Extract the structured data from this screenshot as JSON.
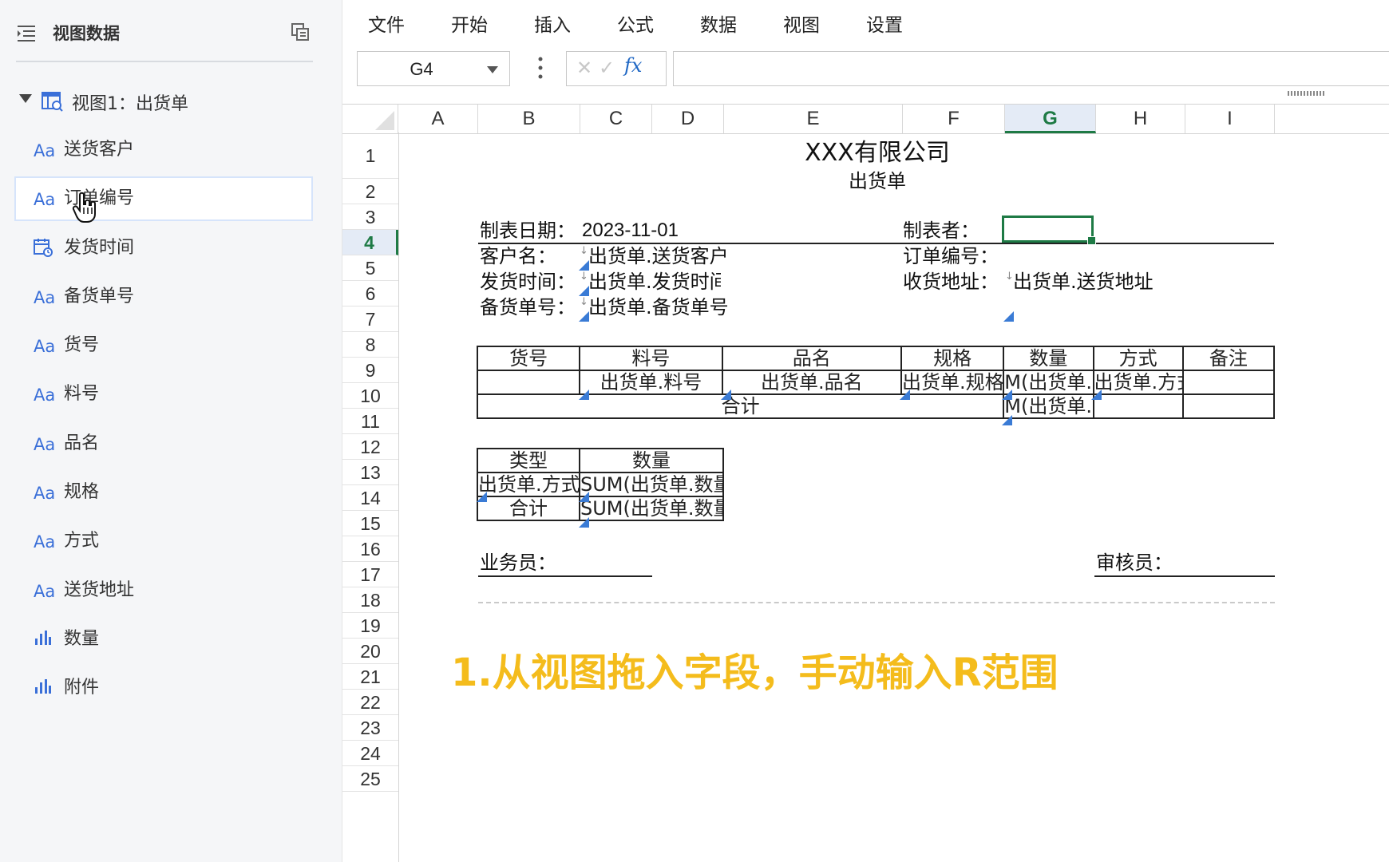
{
  "sidebar": {
    "title": "视图数据",
    "view": {
      "label": "视图1：出货单"
    },
    "fields": [
      {
        "type_icon": "Aa",
        "label": "送货客户"
      },
      {
        "type_icon": "Aa",
        "label": "订单编号"
      },
      {
        "type_icon": "calendar-icon",
        "label": "发货时间"
      },
      {
        "type_icon": "Aa",
        "label": "备货单号"
      },
      {
        "type_icon": "Aa",
        "label": "货号"
      },
      {
        "type_icon": "Aa",
        "label": "料号"
      },
      {
        "type_icon": "Aa",
        "label": "品名"
      },
      {
        "type_icon": "Aa",
        "label": "规格"
      },
      {
        "type_icon": "Aa",
        "label": "方式"
      },
      {
        "type_icon": "Aa",
        "label": "送货地址"
      },
      {
        "type_icon": "bar-chart-icon",
        "label": "数量"
      },
      {
        "type_icon": "bar-chart-icon",
        "label": "附件"
      }
    ],
    "highlighted_field": "订单编号"
  },
  "menubar": {
    "items": [
      "文件",
      "开始",
      "插入",
      "公式",
      "数据",
      "视图",
      "设置"
    ]
  },
  "formula_bar": {
    "name_box": "G4",
    "fx": "fx",
    "cancel": "✕",
    "confirm": "✓",
    "formula": ""
  },
  "columns": [
    "A",
    "B",
    "C",
    "D",
    "E",
    "F",
    "G",
    "H",
    "I"
  ],
  "selected_column": "G",
  "rows": [
    "1",
    "2",
    "3",
    "4",
    "5",
    "6",
    "7",
    "8",
    "9",
    "10",
    "11",
    "12",
    "13",
    "14",
    "15",
    "16",
    "17",
    "18",
    "19",
    "20",
    "21",
    "22",
    "23",
    "24",
    "25"
  ],
  "selected_row": "4",
  "sheet": {
    "company": "XXX有限公司",
    "doc_title": "出货单",
    "date_label": "制表日期：",
    "date_value": "2023-11-01",
    "maker_label": "制表者：",
    "customer_label": "客户名：",
    "customer_value": "出货单.送货客户",
    "order_label": "订单编号：",
    "ship_time_label": "发货时间：",
    "ship_time_value": "出货单.发货时间",
    "address_label": "收货地址：",
    "address_value": "出货单.送货地址",
    "stock_label": "备货单号：",
    "stock_value": "出货单.备货单号",
    "detail_headers": [
      "货号",
      "料号",
      "品名",
      "规格",
      "数量",
      "方式",
      "备注"
    ],
    "detail_row": [
      "",
      "出货单.料号",
      "出货单.品名",
      "出货单.规格",
      "M(出货单.",
      "出货单.方式",
      ""
    ],
    "total_label": "合计",
    "total_qty": "M(出货单.",
    "summary_headers": [
      "类型",
      "数量"
    ],
    "summary_row": [
      "出货单.方式",
      "SUM(出货单.数量"
    ],
    "summary_total": [
      "合计",
      "SUM(出货单.数量"
    ],
    "salesman_label": "业务员：",
    "auditor_label": "审核员："
  },
  "annotation": "1.从视图拖入字段，手动输入R范围",
  "colors": {
    "accent_green": "#1e7a45",
    "annotation": "#f4bc1c",
    "field_icon": "#3a6fd8"
  }
}
